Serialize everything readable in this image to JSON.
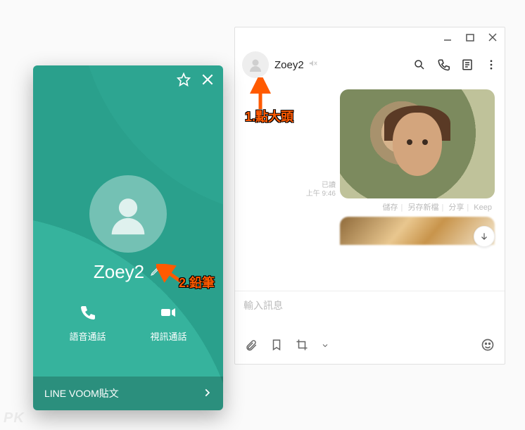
{
  "chat": {
    "contact_name": "Zoey2",
    "muted": true,
    "message": {
      "read_label": "已讀",
      "time": "上午 9:46",
      "links": {
        "save": "儲存",
        "save_as": "另存新檔",
        "share": "分享",
        "keep": "Keep"
      }
    },
    "input_placeholder": "輸入訊息"
  },
  "profile": {
    "name": "Zoey2",
    "voice_call_label": "語音通話",
    "video_call_label": "視訊通話",
    "voom_label": "LINE VOOM貼文"
  },
  "annotations": {
    "step1": "1.點大頭",
    "step2": "2.鉛筆"
  },
  "watermark": "PK"
}
